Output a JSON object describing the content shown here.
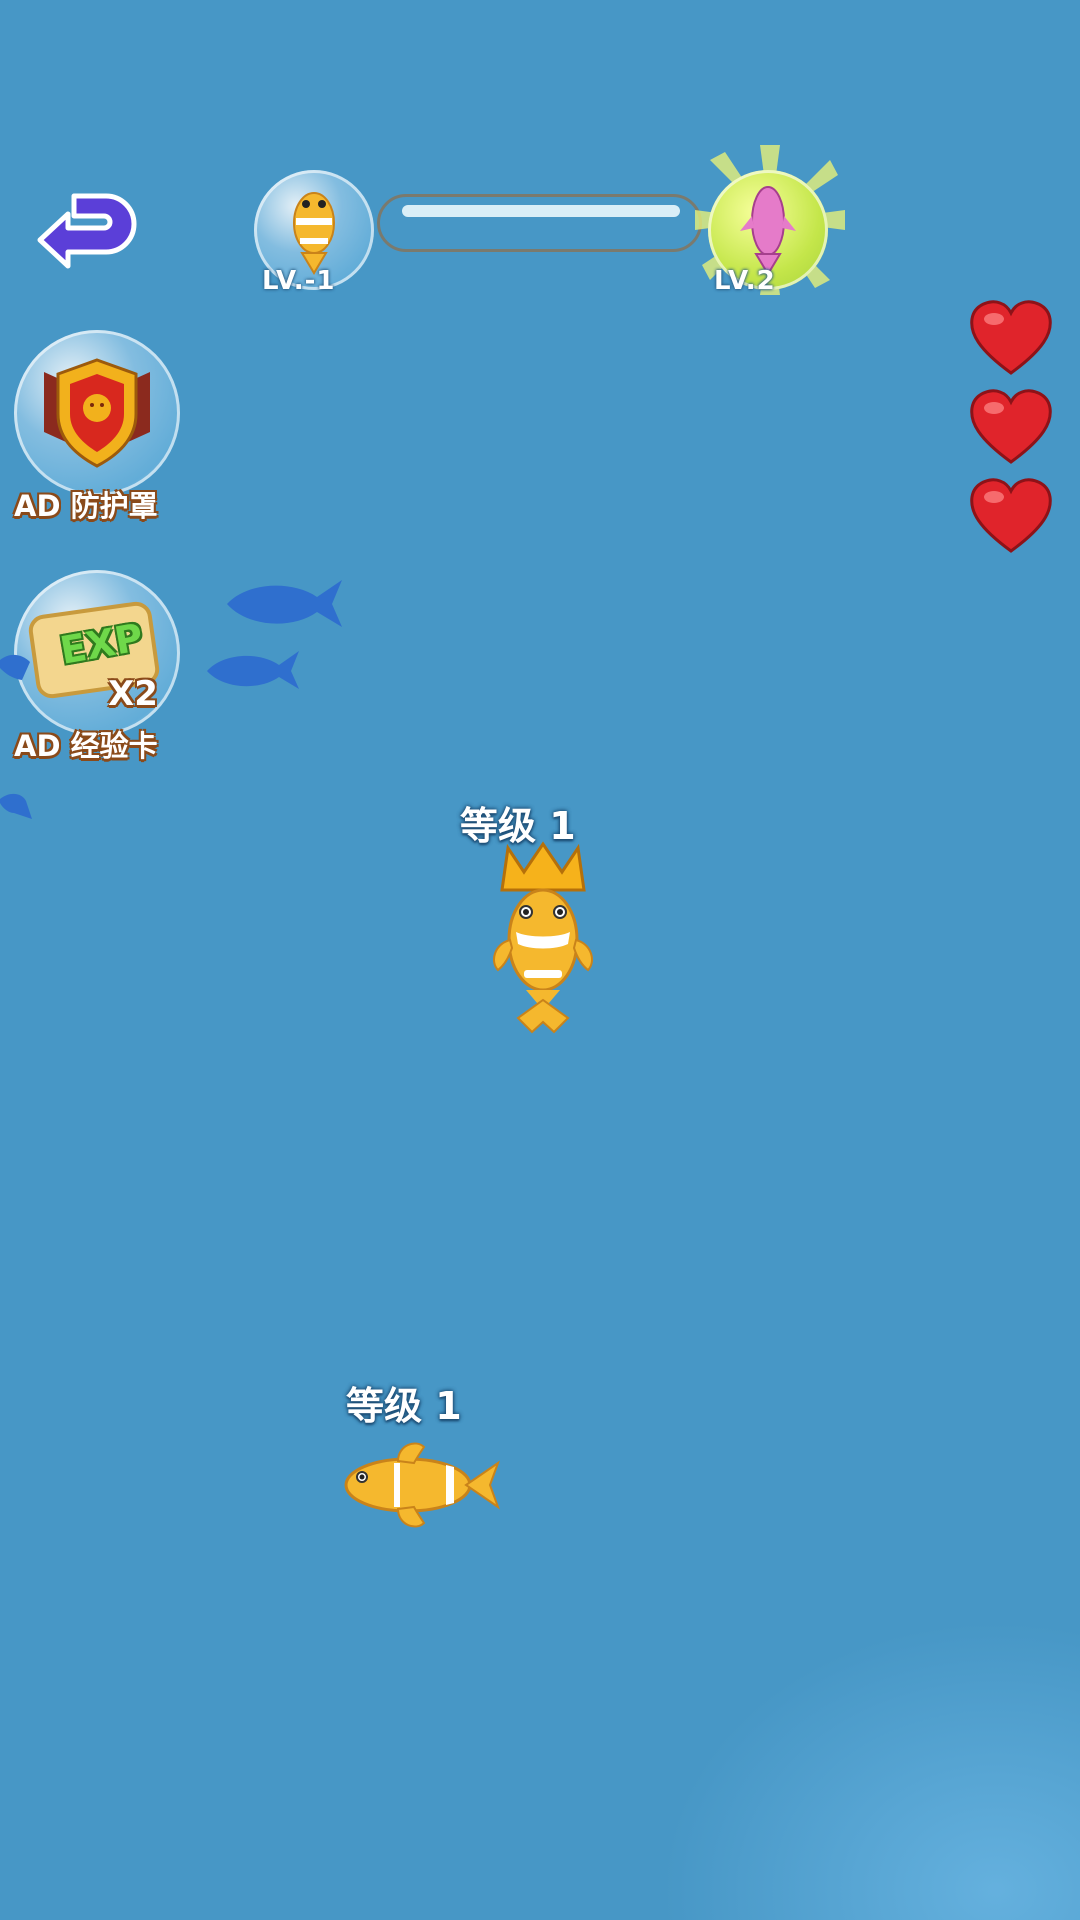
{
  "hud": {
    "current_level_label": "LV.-1",
    "next_level_label": "LV.2",
    "progress": 0.0,
    "lives": 3
  },
  "powerups": [
    {
      "label": "AD 防护罩",
      "icon": "shield-icon"
    },
    {
      "label": "AD 经验卡",
      "icon": "exp-card-icon",
      "card_text": "EXP",
      "multiplier": "X2"
    }
  ],
  "player_fish": {
    "label": "等级 1",
    "icon": "crowned-clownfish-icon"
  },
  "enemy_fish": {
    "label": "等级 1",
    "icon": "clownfish-icon"
  },
  "colors": {
    "water": "#4797c6",
    "heart": "#e0242b",
    "label_outline": "#8a4a1a",
    "fish_body": "#f5b82e"
  }
}
